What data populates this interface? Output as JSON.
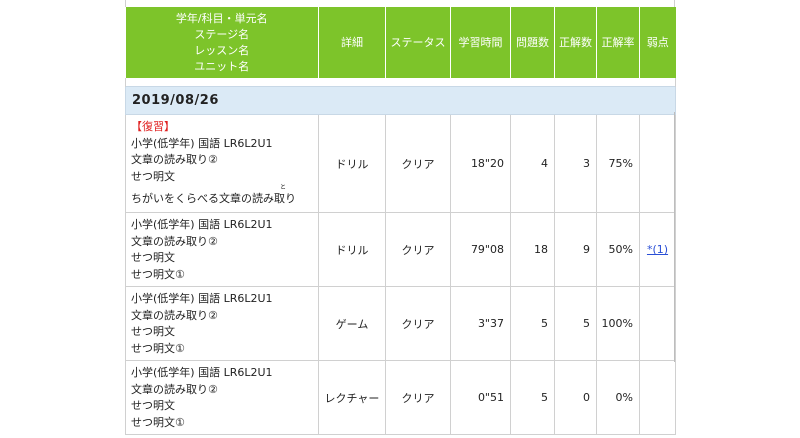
{
  "header": {
    "unit_col": [
      "学年/科目・単元名",
      "ステージ名",
      "レッスン名",
      "ユニット名"
    ],
    "detail": "詳細",
    "status": "ステータス",
    "time": "学習時間",
    "questions": "問題数",
    "correct": "正解数",
    "rate": "正解率",
    "weak": "弱点"
  },
  "date_label": "2019/08/26",
  "rows": [
    {
      "tag": "【復習】",
      "lines": [
        "小学(低学年) 国語 LR6L2U1",
        "文章の読み取り②",
        "せつ明文",
        "ちがいをくらべる文章の読み取り"
      ],
      "ruby": "と",
      "detail": "ドリル",
      "status": "クリア",
      "time": "18\"20",
      "questions": "4",
      "correct": "3",
      "rate": "75%",
      "weak": ""
    },
    {
      "tag": "",
      "lines": [
        "小学(低学年) 国語 LR6L2U1",
        "文章の読み取り②",
        "せつ明文",
        "せつ明文①"
      ],
      "detail": "ドリル",
      "status": "クリア",
      "time": "79\"08",
      "questions": "18",
      "correct": "9",
      "rate": "50%",
      "weak": "*(1)"
    },
    {
      "tag": "",
      "lines": [
        "小学(低学年) 国語 LR6L2U1",
        "文章の読み取り②",
        "せつ明文",
        "せつ明文①"
      ],
      "detail": "ゲーム",
      "status": "クリア",
      "time": "3\"37",
      "questions": "5",
      "correct": "5",
      "rate": "100%",
      "weak": ""
    },
    {
      "tag": "",
      "lines": [
        "小学(低学年) 国語 LR6L2U1",
        "文章の読み取り②",
        "せつ明文",
        "せつ明文①"
      ],
      "detail": "レクチャー",
      "status": "クリア",
      "time": "0\"51",
      "questions": "5",
      "correct": "0",
      "rate": "0%",
      "weak": ""
    }
  ],
  "colors": {
    "header_bg": "#7dc42a",
    "date_bg": "#dbeaf6",
    "review": "#e02020",
    "link": "#2a4fd6"
  }
}
